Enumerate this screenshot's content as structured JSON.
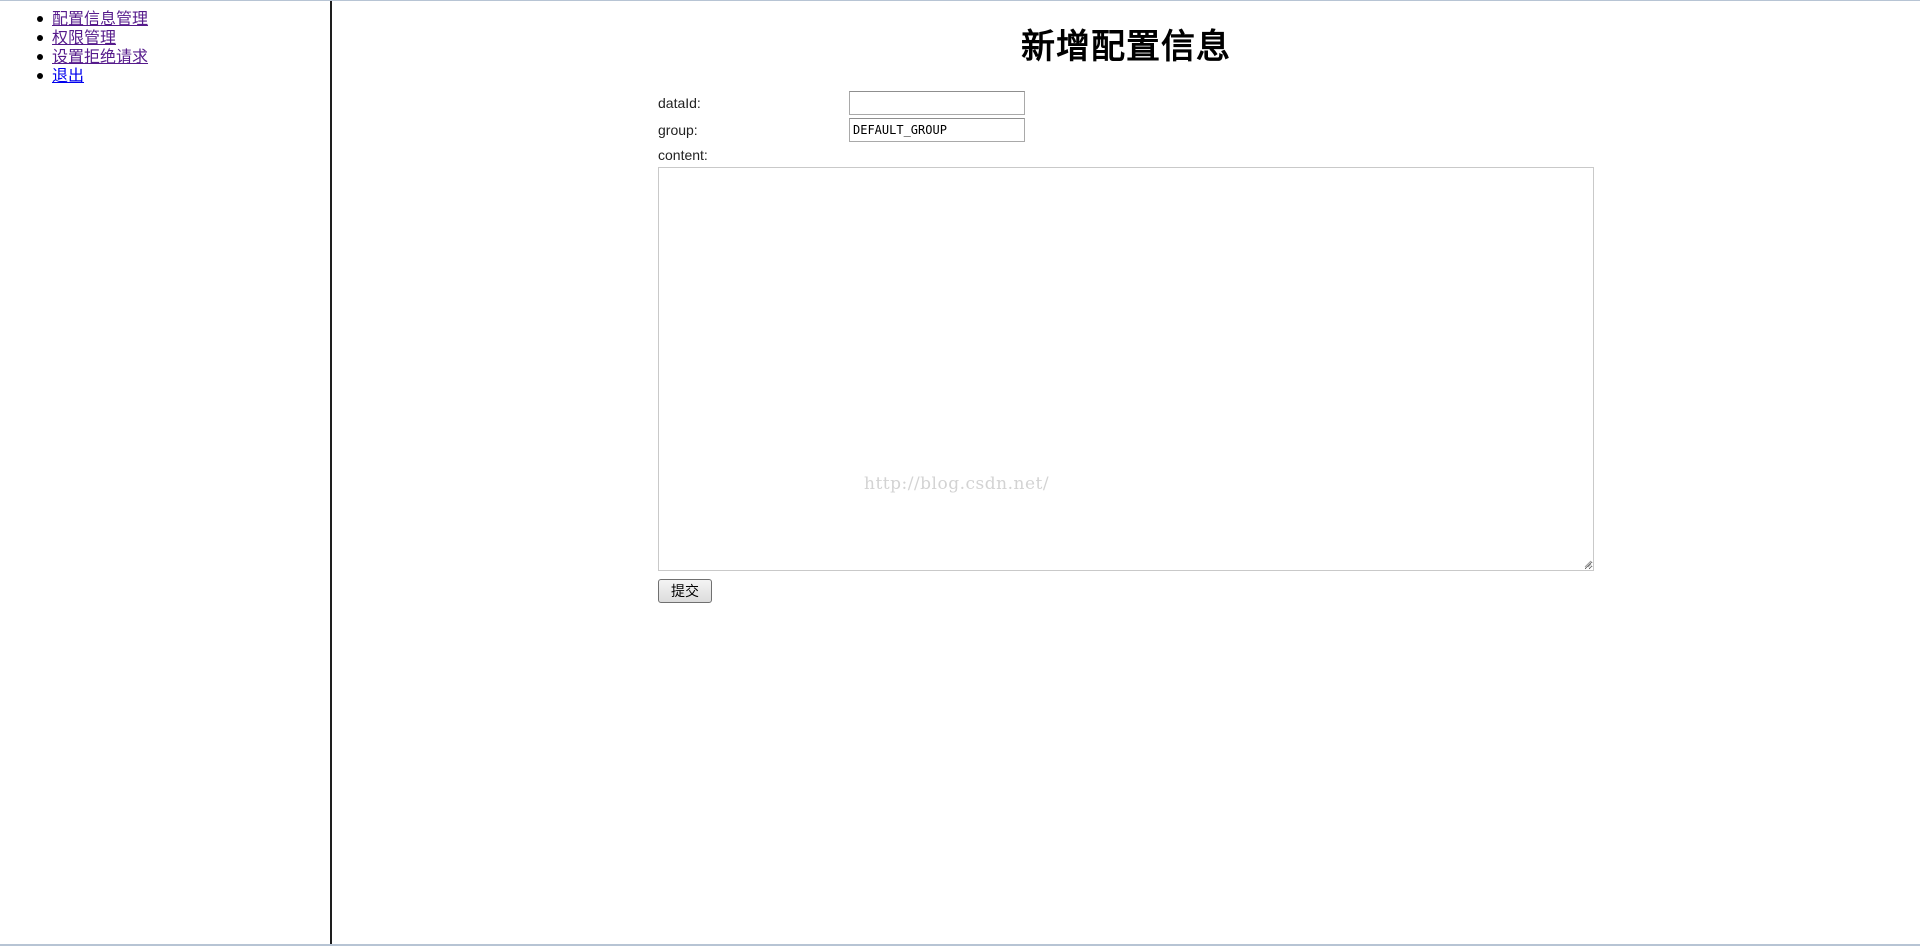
{
  "nav": {
    "items": [
      {
        "label": "配置信息管理",
        "visited": true
      },
      {
        "label": "权限管理",
        "visited": true
      },
      {
        "label": "设置拒绝请求",
        "visited": true
      },
      {
        "label": "退出",
        "visited": false
      }
    ]
  },
  "main": {
    "title": "新增配置信息",
    "form": {
      "dataid_label": "dataId:",
      "dataid_value": "",
      "group_label": "group:",
      "group_value": "DEFAULT_GROUP",
      "content_label": "content:",
      "content_value": "",
      "submit_label": "提交"
    },
    "watermark": "http://blog.csdn.net/"
  },
  "colors": {
    "visited_link": "#551a8b",
    "unvisited_link": "#0000ee",
    "divider": "#1e1e1e"
  }
}
